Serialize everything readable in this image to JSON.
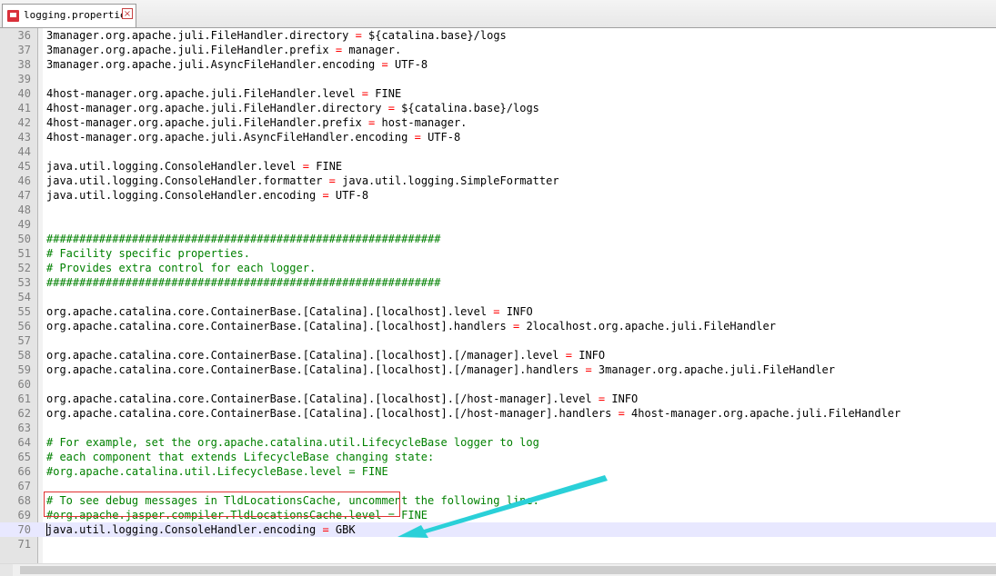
{
  "tab": {
    "title": "logging.properties"
  },
  "lines": [
    {
      "n": "36",
      "key": "3manager.org.apache.juli.FileHandler.directory",
      "eq": "=",
      "val": "${catalina.base}/logs"
    },
    {
      "n": "37",
      "key": "3manager.org.apache.juli.FileHandler.prefix",
      "eq": "=",
      "val": "manager."
    },
    {
      "n": "38",
      "key": "3manager.org.apache.juli.AsyncFileHandler.encoding",
      "eq": "=",
      "val": "UTF-8"
    },
    {
      "n": "39",
      "key": "",
      "eq": "",
      "val": ""
    },
    {
      "n": "40",
      "key": "4host-manager.org.apache.juli.FileHandler.level",
      "eq": "=",
      "val": "FINE"
    },
    {
      "n": "41",
      "key": "4host-manager.org.apache.juli.FileHandler.directory",
      "eq": "=",
      "val": "${catalina.base}/logs"
    },
    {
      "n": "42",
      "key": "4host-manager.org.apache.juli.FileHandler.prefix",
      "eq": "=",
      "val": "host-manager."
    },
    {
      "n": "43",
      "key": "4host-manager.org.apache.juli.AsyncFileHandler.encoding",
      "eq": "=",
      "val": "UTF-8"
    },
    {
      "n": "44",
      "key": "",
      "eq": "",
      "val": ""
    },
    {
      "n": "45",
      "key": "java.util.logging.ConsoleHandler.level",
      "eq": "=",
      "val": "FINE"
    },
    {
      "n": "46",
      "key": "java.util.logging.ConsoleHandler.formatter",
      "eq": "=",
      "val": "java.util.logging.SimpleFormatter"
    },
    {
      "n": "47",
      "key": "java.util.logging.ConsoleHandler.encoding",
      "eq": "=",
      "val": "UTF-8"
    },
    {
      "n": "48",
      "key": "",
      "eq": "",
      "val": ""
    },
    {
      "n": "49",
      "key": "",
      "eq": "",
      "val": ""
    },
    {
      "n": "50",
      "comment": "############################################################"
    },
    {
      "n": "51",
      "comment": "# Facility specific properties."
    },
    {
      "n": "52",
      "comment": "# Provides extra control for each logger."
    },
    {
      "n": "53",
      "comment": "############################################################"
    },
    {
      "n": "54",
      "key": "",
      "eq": "",
      "val": ""
    },
    {
      "n": "55",
      "key": "org.apache.catalina.core.ContainerBase.[Catalina].[localhost].level",
      "eq": "=",
      "val": "INFO"
    },
    {
      "n": "56",
      "key": "org.apache.catalina.core.ContainerBase.[Catalina].[localhost].handlers",
      "eq": "=",
      "val": "2localhost.org.apache.juli.FileHandler"
    },
    {
      "n": "57",
      "key": "",
      "eq": "",
      "val": ""
    },
    {
      "n": "58",
      "key": "org.apache.catalina.core.ContainerBase.[Catalina].[localhost].[/manager].level",
      "eq": "=",
      "val": "INFO"
    },
    {
      "n": "59",
      "key": "org.apache.catalina.core.ContainerBase.[Catalina].[localhost].[/manager].handlers",
      "eq": "=",
      "val": "3manager.org.apache.juli.FileHandler"
    },
    {
      "n": "60",
      "key": "",
      "eq": "",
      "val": ""
    },
    {
      "n": "61",
      "key": "org.apache.catalina.core.ContainerBase.[Catalina].[localhost].[/host-manager].level",
      "eq": "=",
      "val": "INFO"
    },
    {
      "n": "62",
      "key": "org.apache.catalina.core.ContainerBase.[Catalina].[localhost].[/host-manager].handlers",
      "eq": "=",
      "val": "4host-manager.org.apache.juli.FileHandler"
    },
    {
      "n": "63",
      "key": "",
      "eq": "",
      "val": ""
    },
    {
      "n": "64",
      "comment": "# For example, set the org.apache.catalina.util.LifecycleBase logger to log"
    },
    {
      "n": "65",
      "comment": "# each component that extends LifecycleBase changing state:"
    },
    {
      "n": "66",
      "comment": "#org.apache.catalina.util.LifecycleBase.level = FINE"
    },
    {
      "n": "67",
      "key": "",
      "eq": "",
      "val": ""
    },
    {
      "n": "68",
      "comment": "# To see debug messages in TldLocationsCache, uncomment the following line:"
    },
    {
      "n": "69",
      "comment": "#org.apache.jasper.compiler.TldLocationsCache.level = FINE"
    },
    {
      "n": "70",
      "key": "java.util.logging.ConsoleHandler.encoding",
      "eq": "=",
      "val": "GBK",
      "current": true
    },
    {
      "n": "71",
      "key": "",
      "eq": "",
      "val": ""
    }
  ],
  "colors": {
    "comment": "#008000",
    "operator": "#ff0000",
    "current_line": "#e8e8ff",
    "highlight_box": "#e03030",
    "arrow": "#2ad0d8"
  }
}
